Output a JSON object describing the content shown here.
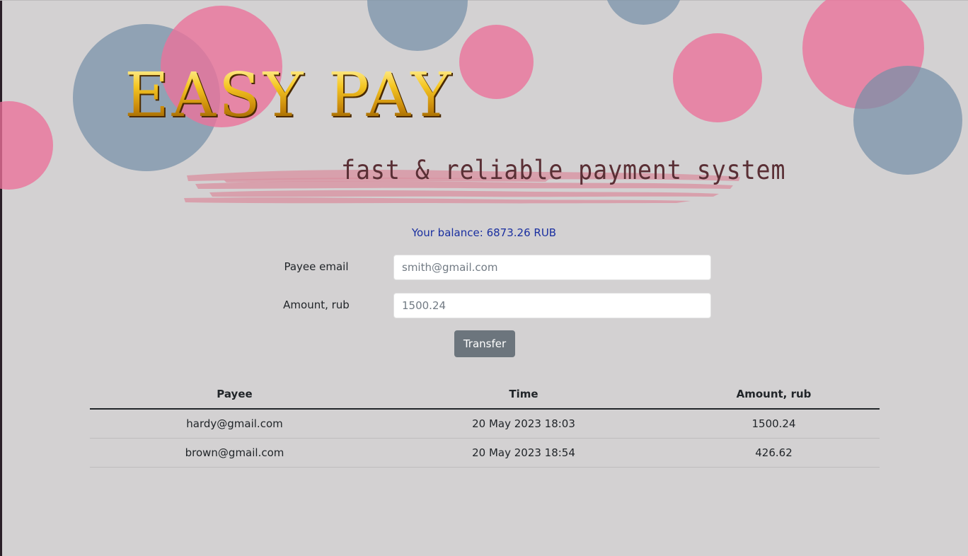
{
  "header": {
    "logo_text": "EASY PAY",
    "tagline": "fast & reliable payment system"
  },
  "balance": {
    "label": "Your balance:",
    "amount": "6873.26",
    "currency": "RUB"
  },
  "form": {
    "payee_email": {
      "label": "Payee email",
      "placeholder": "smith@gmail.com",
      "value": ""
    },
    "amount": {
      "label": "Amount, rub",
      "placeholder": "1500.24",
      "value": ""
    },
    "submit_label": "Transfer"
  },
  "table": {
    "columns": [
      "Payee",
      "Time",
      "Amount, rub"
    ],
    "rows": [
      {
        "payee": "hardy@gmail.com",
        "time": "20 May 2023 18:03",
        "amount": "1500.24"
      },
      {
        "payee": "brown@gmail.com",
        "time": "20 May 2023 18:54",
        "amount": "426.62"
      }
    ]
  },
  "colors": {
    "background": "#d3d1d2",
    "bubble_pink": "#e97ca0",
    "bubble_blue": "#8ea2b5",
    "balance_text": "#1a2fa0",
    "button": "#6c757d",
    "logo_gold": "#e7b414"
  }
}
